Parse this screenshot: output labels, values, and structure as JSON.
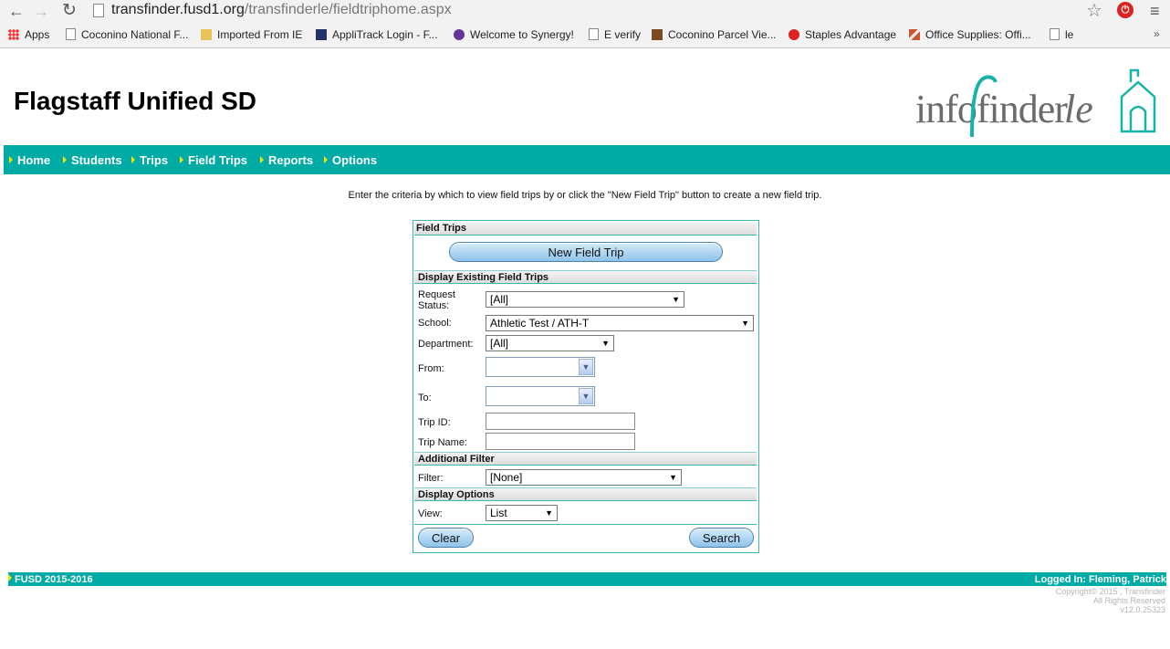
{
  "browser": {
    "url_host": "transfinder.fusd1.org",
    "url_path": "/transfinderle/fieldtriphome.aspx",
    "bookmarks": [
      {
        "label": "Apps",
        "icon": "apps-grid-icon"
      },
      {
        "label": "Coconino National F...",
        "icon": "page-icon"
      },
      {
        "label": "Imported From IE",
        "icon": "folder-icon"
      },
      {
        "label": "AppliTrack Login - F...",
        "icon": "applitrack-icon"
      },
      {
        "label": "Welcome to Synergy!",
        "icon": "synergy-icon"
      },
      {
        "label": "E verify",
        "icon": "page-icon"
      },
      {
        "label": "Coconino Parcel Vie...",
        "icon": "parcel-icon"
      },
      {
        "label": "Staples Advantage",
        "icon": "staples-icon"
      },
      {
        "label": "Office Supplies: Offi...",
        "icon": "pencil-icon"
      },
      {
        "label": "le",
        "icon": "page-icon"
      }
    ],
    "overflow": "»"
  },
  "header": {
    "site_title": "Flagstaff Unified SD",
    "logo_main": "infofinder",
    "logo_suffix": "le"
  },
  "nav": {
    "items": [
      "Home",
      "Students",
      "Trips",
      "Field Trips",
      "Reports",
      "Options"
    ]
  },
  "instructions": "Enter the criteria by which to view field trips by or click the \"New Field Trip\" button to create a new field trip.",
  "panel": {
    "title": "Field Trips",
    "new_button": "New Field Trip",
    "section_existing": "Display Existing Field Trips",
    "request_status_label_1": "Request",
    "request_status_label_2": "Status:",
    "request_status_value": "[All]",
    "school_label": "School:",
    "school_value": "Athletic Test / ATH-T",
    "department_label": "Department:",
    "department_value": "[All]",
    "from_label": "From:",
    "to_label": "To:",
    "trip_id_label": "Trip ID:",
    "trip_name_label": "Trip Name:",
    "section_additional": "Additional Filter",
    "filter_label": "Filter:",
    "filter_value": "[None]",
    "section_display": "Display Options",
    "view_label": "View:",
    "view_value": "List",
    "clear_button": "Clear",
    "search_button": "Search"
  },
  "footer": {
    "left": "FUSD 2015-2016",
    "right": "Logged In: Fleming, Patrick",
    "copyright_1": "Copyright© 2015 , Transfinder",
    "copyright_2": "All Rights Reserved",
    "version": "v12.0.25323"
  },
  "colors": {
    "teal": "#00aaa5",
    "nav_triangle": "#f5e600",
    "logo_teal": "#16b3a8"
  }
}
